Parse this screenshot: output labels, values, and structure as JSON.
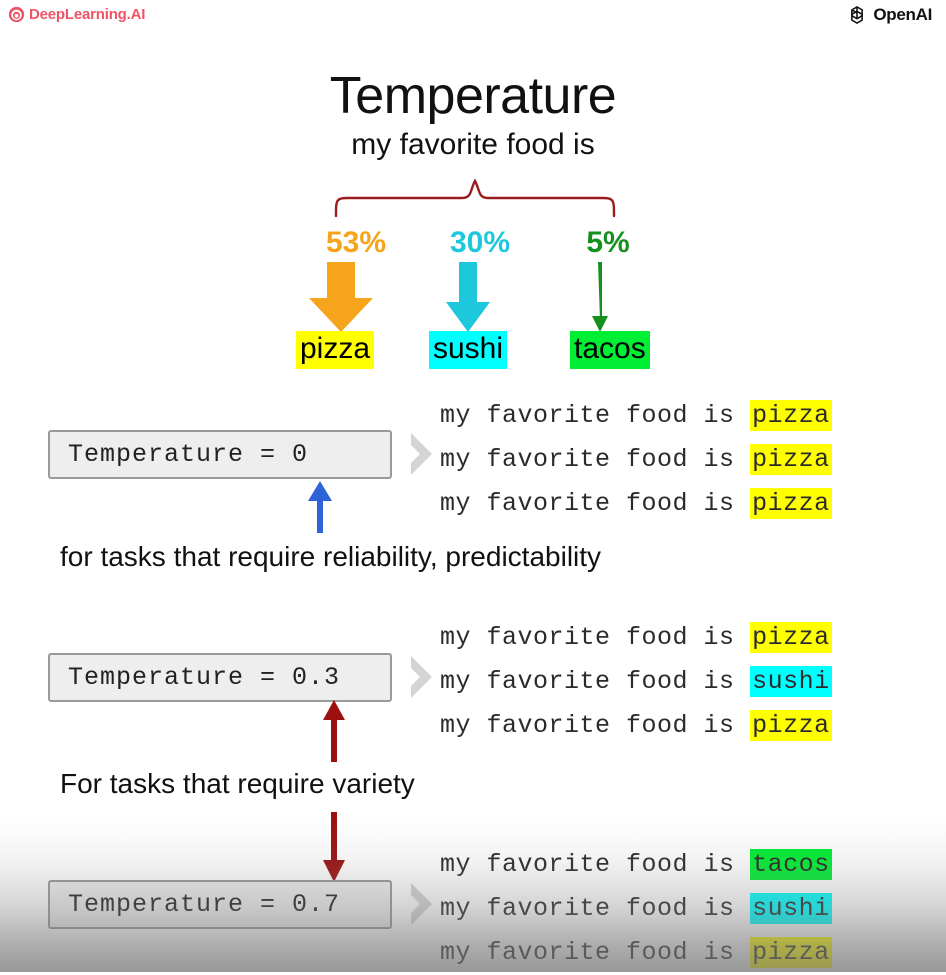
{
  "brand": {
    "left_logo_text": "DeepLearning.AI",
    "left_logo_icon": "deeplearning-spiral-icon",
    "left_logo_color": "#ef5466",
    "right_logo_text": "OpenAI",
    "right_logo_icon": "openai-knot-icon",
    "right_logo_color": "#111111"
  },
  "header": {
    "title": "Temperature",
    "subtitle": "my favorite food is"
  },
  "distribution": {
    "brace_color": "#9b1c1c",
    "tokens": [
      {
        "percent": "53%",
        "label": "pizza",
        "color": "#f5a41c",
        "highlight": "#ffff00",
        "arrow": "thick-down-arrow-icon"
      },
      {
        "percent": "30%",
        "label": "sushi",
        "color": "#1ec8dc",
        "highlight": "#00ffff",
        "arrow": "medium-down-arrow-icon"
      },
      {
        "percent": "5%",
        "label": "tacos",
        "color": "#15901f",
        "highlight": "#00ee33",
        "arrow": "thin-down-arrow-icon"
      }
    ]
  },
  "blocks": [
    {
      "temperature_label": "Temperature = 0",
      "chevron_icon": "chevron-right-icon",
      "outputs": [
        {
          "prefix": "my favorite food is ",
          "token": "pizza",
          "highlight": "yellow"
        },
        {
          "prefix": "my favorite food is ",
          "token": "pizza",
          "highlight": "yellow"
        },
        {
          "prefix": "my favorite food is ",
          "token": "pizza",
          "highlight": "yellow"
        }
      ],
      "caption": "for tasks that require reliability, predictability",
      "connector_icon": "blue-up-arrow-icon",
      "connector_color": "#2e64d8"
    },
    {
      "temperature_label": "Temperature = 0.3",
      "chevron_icon": "chevron-right-icon",
      "outputs": [
        {
          "prefix": "my favorite food is ",
          "token": "pizza",
          "highlight": "yellow"
        },
        {
          "prefix": "my favorite food is ",
          "token": "sushi",
          "highlight": "cyan"
        },
        {
          "prefix": "my favorite food is ",
          "token": "pizza",
          "highlight": "yellow"
        }
      ],
      "caption": "For tasks that require variety",
      "connector_icon": "dark-red-double-arrow-icon",
      "connector_color": "#9b1111"
    },
    {
      "temperature_label": "Temperature = 0.7",
      "chevron_icon": "chevron-right-icon",
      "outputs": [
        {
          "prefix": "my favorite food is ",
          "token": "tacos",
          "highlight": "green"
        },
        {
          "prefix": "my favorite food is ",
          "token": "sushi",
          "highlight": "cyan"
        },
        {
          "prefix": "my favorite food is ",
          "token": "pizza",
          "highlight": "yellow"
        }
      ]
    }
  ]
}
